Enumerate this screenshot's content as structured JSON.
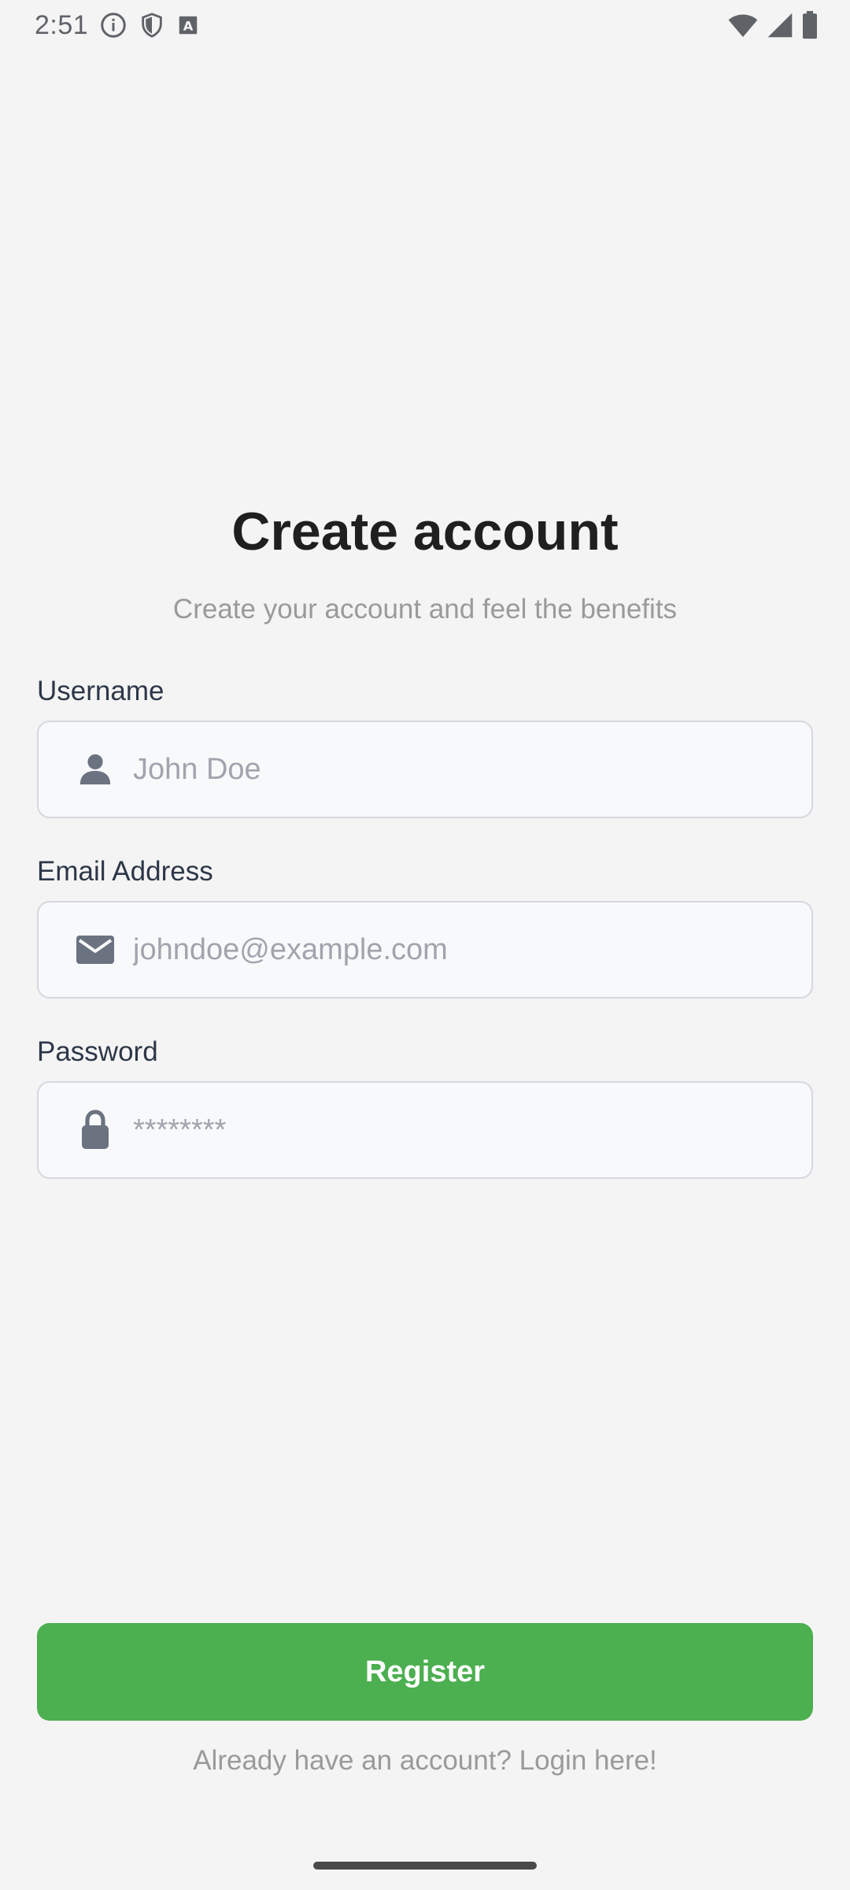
{
  "status_bar": {
    "time": "2:51",
    "icons": [
      "info-icon",
      "shield-icon",
      "a-box-icon",
      "wifi-icon",
      "signal-icon",
      "battery-icon"
    ]
  },
  "header": {
    "title": "Create account",
    "subtitle": "Create your account and feel the benefits"
  },
  "form": {
    "username": {
      "label": "Username",
      "placeholder": "John Doe",
      "icon": "person-icon"
    },
    "email": {
      "label": "Email Address",
      "placeholder": "johndoe@example.com",
      "icon": "mail-icon"
    },
    "password": {
      "label": "Password",
      "placeholder": "********",
      "icon": "lock-icon"
    }
  },
  "actions": {
    "register_label": "Register",
    "login_prompt": "Already have an account? Login here!"
  },
  "colors": {
    "accent": "#4caf50",
    "background": "#f4f4f4",
    "field_background": "#f8f9fb",
    "field_border": "#d5d8dd",
    "icon": "#6b7280"
  }
}
